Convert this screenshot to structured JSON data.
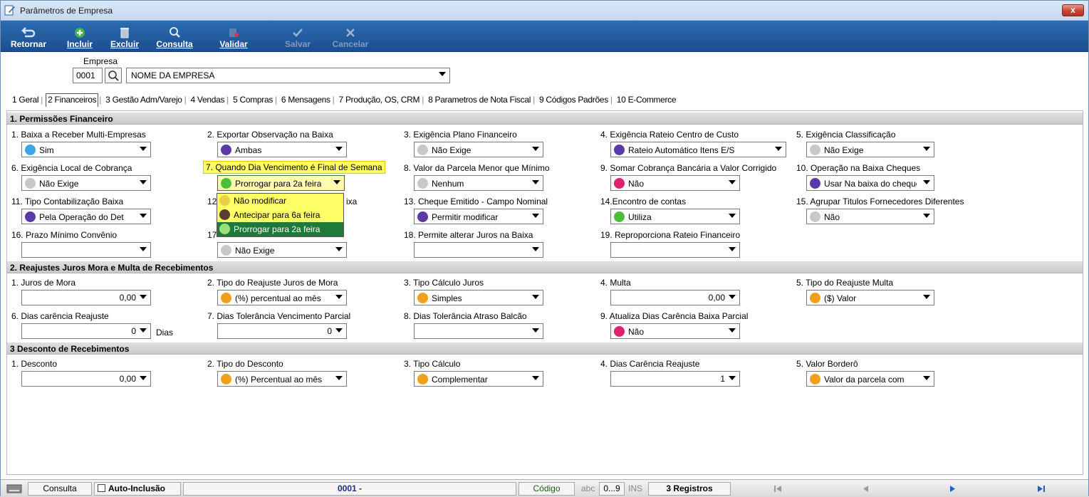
{
  "window": {
    "title": "Parâmetros de Empresa",
    "close_label": "x"
  },
  "toolbar": {
    "retornar": "Retornar",
    "incluir": "Incluir",
    "excluir": "Excluir",
    "consulta": "Consulta",
    "validar": "Validar",
    "salvar": "Salvar",
    "cancelar": "Cancelar"
  },
  "empresa": {
    "label": "Empresa",
    "code": "0001",
    "name": "NOME DA EMPRESA"
  },
  "tabs": [
    "1 Geral",
    "2 Financeiros",
    "3 Gestão Adm/Varejo",
    "4 Vendas",
    "5 Compras",
    "6 Mensagens",
    "7 Produção, OS, CRM",
    "8 Parametros de Nota Fiscal",
    "9 Códigos Padrões",
    "10 E-Commerce"
  ],
  "colors": {
    "blue": "#3aa8e8",
    "purple": "#5b3aa8",
    "gray": "#c8c8c8",
    "green": "#4cbf3a",
    "pink": "#e0216e",
    "orange": "#f2a01c",
    "brown": "#5a3d2a",
    "lightgreen": "#9be07a"
  },
  "sections": {
    "s1": "1. Permissões Financeiro",
    "s2": "2. Reajustes Juros Mora e Multa de Recebimentos",
    "s3": "3 Desconto de Recebimentos"
  },
  "s1": {
    "f1": {
      "label": "1. Baixa a Receber Multi-Empresas",
      "value": "Sim"
    },
    "f2": {
      "label": "2. Exportar Observação na Baixa",
      "value": "Ambas"
    },
    "f3": {
      "label": "3. Exigência Plano Financeiro",
      "value": "Não Exige"
    },
    "f4": {
      "label": "4. Exigência Rateio Centro de Custo",
      "value": "Rateio Automático Itens E/S"
    },
    "f5": {
      "label": "5. Exigência Classificação",
      "value": "Não Exige"
    },
    "f6": {
      "label": "6. Exigência Local de Cobrança",
      "value": "Não Exige"
    },
    "f7": {
      "label": "7. Quando Dia Vencimento é Final de Semana",
      "value": "Prorrogar para 2a feira"
    },
    "f8": {
      "label": "8. Valor da Parcela Menor que Mínimo",
      "value": "Nenhum"
    },
    "f9": {
      "label": "9. Somar Cobrança Bancária a Valor Corrigido",
      "value": "Não"
    },
    "f10": {
      "label": "10. Operação na Baixa Cheques",
      "value": "Usar Na baixa do cheque"
    },
    "f11": {
      "label": "11. Tipo Contabilização Baixa",
      "value": "Pela Operação do Det"
    },
    "f12": {
      "label": "12",
      "label_tail": "ixa"
    },
    "f13": {
      "label": "13. Cheque Emitido - Campo Nominal",
      "value": "Permitir modificar"
    },
    "f14": {
      "label": "14.Encontro de contas",
      "value": "Utiliza"
    },
    "f15": {
      "label": "15. Agrupar Titulos Fornecedores Diferentes",
      "value": "Não"
    },
    "f16": {
      "label": "16. Prazo Mínimo Convênio",
      "value": ""
    },
    "f17": {
      "label": "17",
      "value": "Não Exige"
    },
    "f18": {
      "label": "18. Permite alterar Juros na Baixa",
      "value": ""
    },
    "f19": {
      "label": "19. Reproporciona Rateio Financeiro",
      "value": ""
    }
  },
  "dropdown": {
    "options": [
      "Não modificar",
      "Antecipar para 6a feira",
      "Prorrogar para 2a feira"
    ],
    "selected_index": 2
  },
  "s2": {
    "f1": {
      "label": "1. Juros de Mora",
      "value": "0,00"
    },
    "f2": {
      "label": "2. Tipo do Reajuste Juros de Mora",
      "value": "(%) percentual ao mês"
    },
    "f3": {
      "label": "3. Tipo Cálculo Juros",
      "value": "Simples"
    },
    "f4": {
      "label": "4. Multa",
      "value": "0,00"
    },
    "f5": {
      "label": "5. Tipo do Reajuste Multa",
      "value": "($) Valor"
    },
    "f6": {
      "label": "6. Dias carência Reajuste",
      "value": "0",
      "suffix": "Dias"
    },
    "f7": {
      "label": "7. Dias Tolerância Vencimento Parcial",
      "value": "0"
    },
    "f8": {
      "label": "8. Dias Tolerância Atraso Balcão",
      "value": ""
    },
    "f9": {
      "label": "9. Atualiza Dias Carência Baixa Parcial",
      "value": "Não"
    }
  },
  "s3": {
    "f1": {
      "label": "1. Desconto",
      "value": "0,00"
    },
    "f2": {
      "label": "2. Tipo do Desconto",
      "value": "(%) Percentual ao mês"
    },
    "f3": {
      "label": "3. Tipo Cálculo",
      "value": "Complementar"
    },
    "f4": {
      "label": "4. Dias Carência Reajuste",
      "value": "1"
    },
    "f5": {
      "label": "5. Valor Borderô",
      "value": "Valor da parcela com"
    }
  },
  "status": {
    "mode": "Consulta",
    "auto_inclusao": "Auto-Inclusão",
    "record": "0001 -",
    "codigo": "Código",
    "abc": "abc",
    "digits": "0...9",
    "ins": "INS",
    "registros": "3 Registros"
  }
}
